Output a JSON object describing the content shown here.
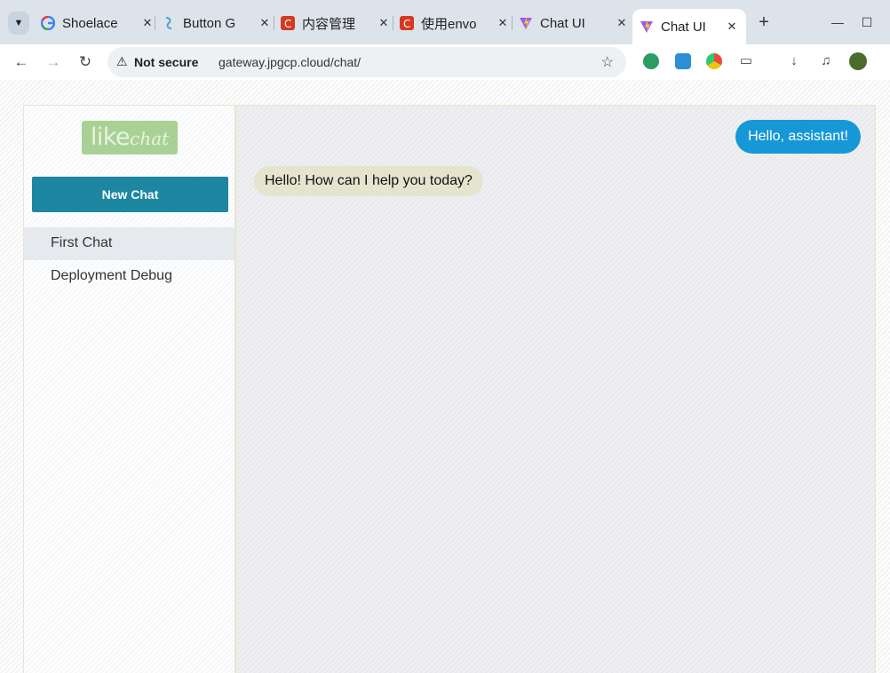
{
  "browser": {
    "tabs": [
      {
        "label": "Shoelace",
        "favicon": "google-icon",
        "active": false
      },
      {
        "label": "Button G",
        "favicon": "shoelace-icon",
        "active": false
      },
      {
        "label": "内容管理",
        "favicon": "c-red-icon",
        "active": false
      },
      {
        "label": "使用envo",
        "favicon": "c-red-icon",
        "active": false
      },
      {
        "label": "Chat UI",
        "favicon": "vite-icon",
        "active": false
      },
      {
        "label": "Chat UI",
        "favicon": "vite-icon",
        "active": true
      }
    ],
    "new_tab": "+",
    "minimize": "—",
    "maximize": "☐",
    "address": {
      "security_label": "Not secure",
      "url": "gateway.jpgcp.cloud/chat/"
    }
  },
  "app": {
    "logo_like": "like",
    "logo_chat": "chat",
    "new_chat_label": "New Chat",
    "chats": [
      {
        "title": "First Chat",
        "selected": true
      },
      {
        "title": "Deployment Debug",
        "selected": false
      }
    ],
    "messages": [
      {
        "role": "user",
        "text": "Hello, assistant!"
      },
      {
        "role": "assistant",
        "text": "Hello! How can I help you today?"
      }
    ]
  },
  "colors": {
    "accent": "#1d86a1",
    "user_bubble": "#1798d6",
    "assistant_bubble": "#e5e5cf",
    "logo_bg": "#a9d195"
  }
}
